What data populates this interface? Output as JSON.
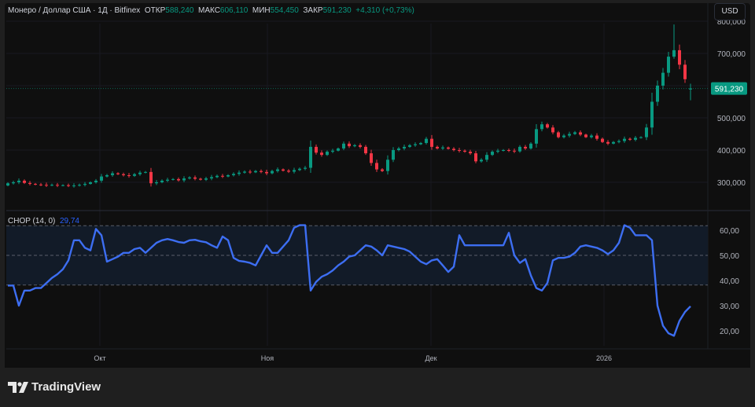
{
  "legend": {
    "symbol": "Монеро / Доллар США · 1Д · Bitfinex",
    "open_label": "ОТКР",
    "open": "588,240",
    "high_label": "МАКС",
    "high": "606,110",
    "low_label": "МИН",
    "low": "554,450",
    "close_label": "ЗАКР",
    "close": "591,230",
    "change": "+4,310 (+0,73%)"
  },
  "currency_button": "USD",
  "brand": "TradingView",
  "colors": {
    "up": "#089981",
    "down": "#f23645",
    "chop_line": "#3d6ef2",
    "chop_band": "#121b28",
    "background": "#0f0f0f"
  },
  "chart_data": [
    {
      "type": "candlestick",
      "title": "Монеро / Доллар США · 1Д · Bitfinex",
      "y_ticks": [
        "300,000",
        "400,000",
        "500,000",
        "600,000",
        "700,000",
        "800,000"
      ],
      "ylim": [
        260,
        820
      ],
      "y_unit": "thousands USD",
      "x_ticks": [
        "Окт",
        "Ноя",
        "Дек",
        "2026"
      ],
      "last_price_label": "591,230",
      "last_candle": {
        "open": 588.24,
        "high": 606.11,
        "low": 554.45,
        "close": 591.23
      },
      "closes": [
        297,
        300,
        305,
        298,
        295,
        293,
        292,
        291,
        292,
        290,
        291,
        289,
        290,
        292,
        295,
        300,
        305,
        318,
        322,
        328,
        325,
        322,
        320,
        325,
        330,
        332,
        297,
        300,
        305,
        308,
        310,
        306,
        312,
        315,
        311,
        308,
        312,
        316,
        320,
        318,
        322,
        326,
        330,
        333,
        331,
        335,
        332,
        328,
        335,
        340,
        336,
        333,
        338,
        342,
        345,
        410,
        392,
        385,
        395,
        398,
        405,
        420,
        412,
        415,
        410,
        390,
        360,
        340,
        335,
        370,
        400,
        405,
        410,
        415,
        418,
        422,
        435,
        410,
        405,
        408,
        404,
        400,
        398,
        395,
        390,
        365,
        370,
        385,
        395,
        398,
        400,
        398,
        396,
        410,
        405,
        420,
        465,
        480,
        470,
        455,
        440,
        445,
        450,
        455,
        448,
        440,
        445,
        435,
        425,
        420,
        425,
        428,
        435,
        432,
        438,
        440,
        470,
        550,
        600,
        640,
        690,
        710,
        665,
        620,
        591.23
      ]
    },
    {
      "type": "line",
      "title": "CHOP (14, 0)",
      "current_value_label": "29,74",
      "y_ticks": [
        "60,00",
        "50,00",
        "40,00",
        "30,00",
        "20,00"
      ],
      "bands": [
        61.8,
        50,
        38.2
      ],
      "values": [
        38,
        38,
        30,
        36,
        36,
        37,
        37,
        39,
        41,
        42.5,
        44.5,
        48,
        56,
        56,
        53,
        52,
        60.5,
        58,
        47.5,
        48.5,
        49.5,
        51,
        51,
        52.5,
        53,
        51,
        53,
        55,
        56,
        56.5,
        56,
        55.3,
        55,
        56,
        56.2,
        55.6,
        55.2,
        54,
        53,
        57.5,
        56,
        49,
        47.8,
        47.5,
        47,
        46,
        50,
        54,
        51,
        51,
        53.5,
        56,
        61,
        62,
        62,
        36,
        39.5,
        41.5,
        42.5,
        44,
        46,
        47.5,
        49.5,
        50,
        52,
        54,
        53.5,
        52,
        50,
        54,
        53.5,
        53,
        52.5,
        51.5,
        49.5,
        47.5,
        46.5,
        48,
        48.5,
        46,
        43.4,
        45.5,
        58,
        54,
        54,
        54,
        54,
        54,
        54,
        54,
        54,
        59,
        50,
        47,
        48.5,
        42,
        37,
        36,
        39,
        48,
        49,
        49,
        49.5,
        51,
        53.5,
        54,
        53.5,
        53,
        52,
        50.5,
        52,
        55,
        62,
        61,
        58,
        58,
        58,
        56,
        30,
        22,
        19,
        18,
        24,
        27.5,
        29.74
      ]
    }
  ]
}
